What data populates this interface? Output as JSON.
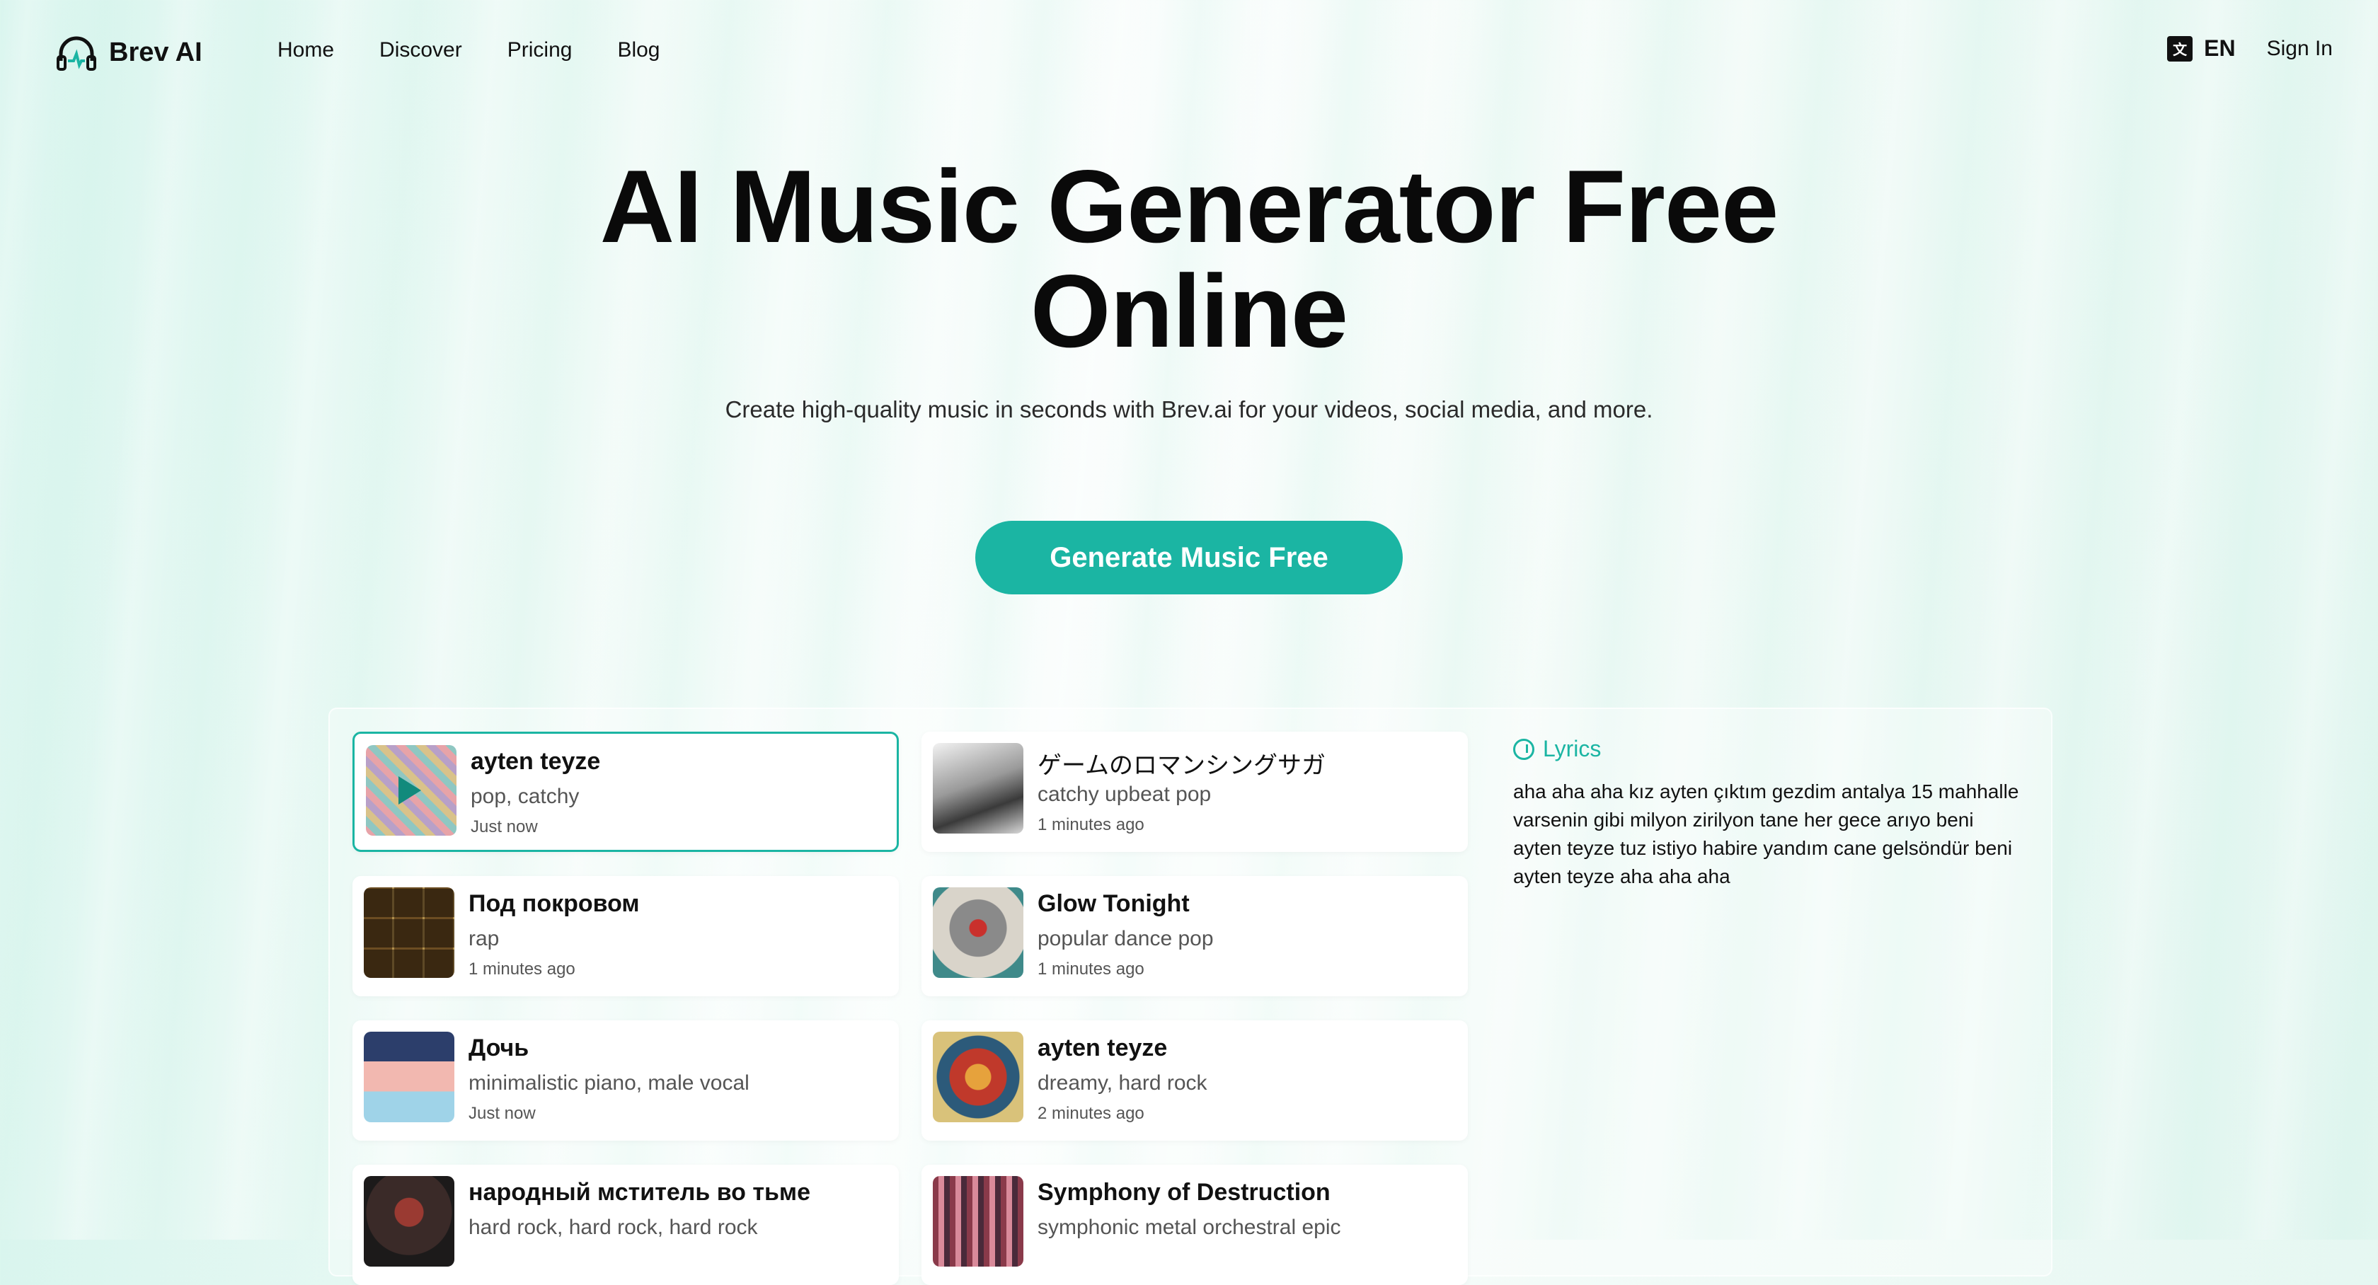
{
  "app": {
    "name": "Brev AI"
  },
  "nav": {
    "items": [
      "Home",
      "Discover",
      "Pricing",
      "Blog"
    ]
  },
  "header": {
    "lang": "EN",
    "signin": "Sign In"
  },
  "hero": {
    "title_line1": "AI Music Generator Free",
    "title_line2": "Online",
    "subtitle": "Create high-quality music in seconds with Brev.ai for your videos, social media, and more.",
    "cta": "Generate Music Free"
  },
  "songs": [
    {
      "title": "ayten teyze",
      "tags": "pop, catchy",
      "time": "Just now",
      "active": true
    },
    {
      "title": "ゲームのロマンシングサガ",
      "tags": "catchy upbeat pop",
      "time": "1 minutes ago"
    },
    {
      "title": "Под покровом",
      "tags": "rap",
      "time": "1 minutes ago"
    },
    {
      "title": "Glow Tonight",
      "tags": "popular dance pop",
      "time": "1 minutes ago"
    },
    {
      "title": "Дочь",
      "tags": "minimalistic piano, male vocal",
      "time": "Just now"
    },
    {
      "title": "ayten teyze",
      "tags": "dreamy, hard rock",
      "time": "2 minutes ago"
    },
    {
      "title": "народный мститель во тьме",
      "tags": "hard rock, hard rock, hard rock",
      "time": ""
    },
    {
      "title": "Symphony of Destruction",
      "tags": "symphonic metal orchestral epic",
      "time": ""
    }
  ],
  "lyrics": {
    "heading": "Lyrics",
    "text": "aha aha aha kız ayten çıktım gezdim antalya 15 mahhalle varsenin gibi milyon zirilyon tane her gece arıyo beni ayten teyze tuz istiyo habire yandım cane gelsöndür beni ayten teyze aha aha aha"
  },
  "colors": {
    "accent": "#1bb5a3"
  }
}
